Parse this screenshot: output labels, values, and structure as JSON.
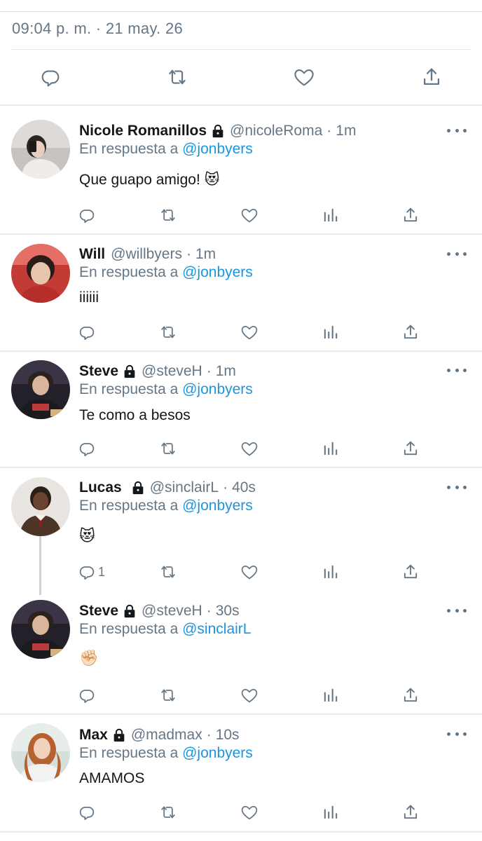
{
  "tweet": {
    "timestamp": "09:04 p. m. · 21 may. 26",
    "actions": [
      "reply-icon",
      "retweet-icon",
      "like-icon",
      "share-icon"
    ]
  },
  "replies": [
    {
      "name": "Nicole Romanillos",
      "handle": "@nicoleRoma",
      "time": "1m",
      "replying_prefix": "En respuesta a",
      "replying_to": "@jonbyers",
      "text": "Que guapo amigo! 😻",
      "locked": true
    },
    {
      "name": "Will",
      "handle": "@willbyers",
      "time": "1m",
      "replying_prefix": "En respuesta a",
      "replying_to": "@jonbyers",
      "text": "iiiiii",
      "locked": false
    },
    {
      "name": "Steve",
      "handle": "@steveH",
      "time": "1m",
      "replying_prefix": "En respuesta a",
      "replying_to": "@jonbyers",
      "text": "Te como a besos",
      "locked": true
    },
    {
      "name": "Lucas",
      "handle": "@sinclairL",
      "time": "40s",
      "replying_prefix": "En respuesta a",
      "replying_to": "@jonbyers",
      "text": "😻",
      "reply_count": "1",
      "locked": true
    },
    {
      "name": "Steve",
      "handle": "@steveH",
      "time": "30s",
      "replying_prefix": "En respuesta a",
      "replying_to": "@sinclairL",
      "text": "✊🏻",
      "locked": true
    },
    {
      "name": "Max",
      "handle": "@madmax",
      "time": "10s",
      "replying_prefix": "En respuesta a",
      "replying_to": "@jonbyers",
      "text": "AMAMOS",
      "locked": true
    }
  ],
  "colors": {
    "accent": "#1b95e0",
    "secondary_text": "#657786",
    "divider": "#e6ecf0"
  }
}
